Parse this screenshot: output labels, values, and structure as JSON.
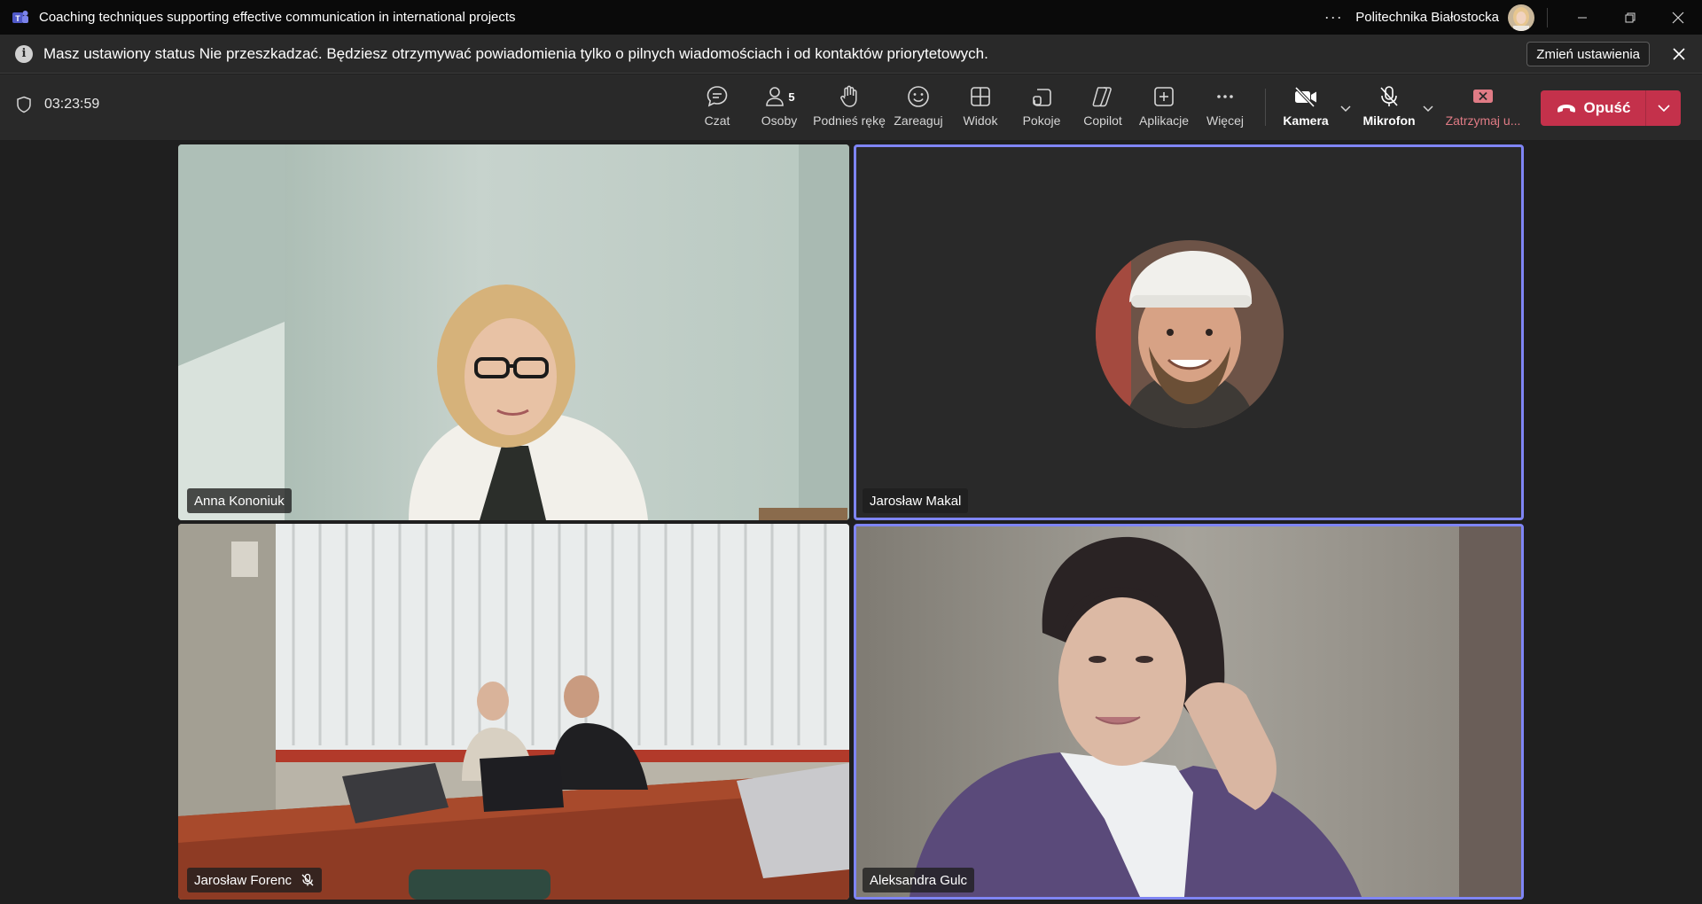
{
  "window": {
    "title": "Coaching techniques supporting effective communication in international projects",
    "organization": "Politechnika Białostocka",
    "more_label": "···"
  },
  "banner": {
    "message": "Masz ustawiony status Nie przeszkadzać. Będziesz otrzymywać powiadomienia tylko o pilnych wiadomościach i od kontaktów priorytetowych.",
    "button_label": "Zmień ustawienia",
    "info_glyph": "i"
  },
  "toolbar": {
    "timer": "03:23:59",
    "people_count": "5",
    "items": [
      {
        "label": "Czat",
        "icon": "chat-icon"
      },
      {
        "label": "Osoby",
        "icon": "people-icon"
      },
      {
        "label": "Podnieś rękę",
        "icon": "raise-hand-icon"
      },
      {
        "label": "Zareaguj",
        "icon": "react-icon"
      },
      {
        "label": "Widok",
        "icon": "view-icon"
      },
      {
        "label": "Pokoje",
        "icon": "rooms-icon"
      },
      {
        "label": "Copilot",
        "icon": "copilot-icon"
      },
      {
        "label": "Aplikacje",
        "icon": "apps-icon"
      },
      {
        "label": "Więcej",
        "icon": "more-icon"
      },
      {
        "label": "Kamera",
        "icon": "camera-off-icon"
      },
      {
        "label": "Mikrofon",
        "icon": "mic-off-icon"
      },
      {
        "label": "Zatrzymaj u...",
        "icon": "stop-share-icon"
      }
    ],
    "leave_label": "Opuść",
    "colors": {
      "leave": "#c4314b",
      "speaking_border": "#7f85f5",
      "stop_label": "#e07b85"
    }
  },
  "participants": [
    {
      "name": "Anna Kononiuk",
      "video": true,
      "speaking": false,
      "muted": false
    },
    {
      "name": "Jarosław Makal",
      "video": false,
      "speaking": true,
      "muted": false
    },
    {
      "name": "Jarosław Forenc",
      "video": true,
      "speaking": false,
      "muted": true
    },
    {
      "name": "Aleksandra Gulc",
      "video": true,
      "speaking": true,
      "muted": false
    }
  ]
}
